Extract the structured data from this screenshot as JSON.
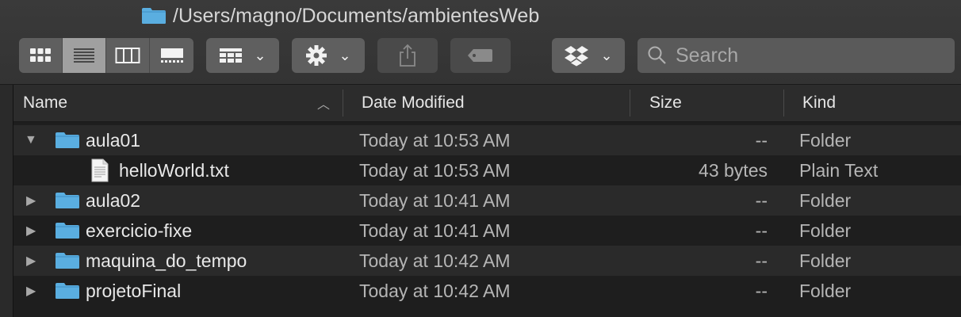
{
  "window": {
    "path": "/Users/magno/Documents/ambientesWeb"
  },
  "toolbar": {
    "view_modes": [
      "icon-view",
      "list-view",
      "column-view",
      "gallery-view"
    ],
    "active_view": "list-view",
    "group_icon": "group-grid-icon",
    "action_icon": "gear-icon",
    "share_icon": "share-icon",
    "tag_icon": "tag-icon",
    "dropbox_icon": "dropbox-icon",
    "search": {
      "placeholder": "Search"
    }
  },
  "columns": {
    "name": "Name",
    "date": "Date Modified",
    "size": "Size",
    "kind": "Kind"
  },
  "files": [
    {
      "name": "aula01",
      "date": "Today at 10:53 AM",
      "size": "--",
      "kind": "Folder",
      "type": "folder",
      "expanded": true,
      "level": 0
    },
    {
      "name": "helloWorld.txt",
      "date": "Today at 10:53 AM",
      "size": "43 bytes",
      "kind": "Plain Text",
      "type": "file",
      "level": 1
    },
    {
      "name": "aula02",
      "date": "Today at 10:41 AM",
      "size": "--",
      "kind": "Folder",
      "type": "folder",
      "expanded": false,
      "level": 0
    },
    {
      "name": "exercicio-fixe",
      "date": "Today at 10:41 AM",
      "size": "--",
      "kind": "Folder",
      "type": "folder",
      "expanded": false,
      "level": 0
    },
    {
      "name": "maquina_do_tempo",
      "date": "Today at 10:42 AM",
      "size": "--",
      "kind": "Folder",
      "type": "folder",
      "expanded": false,
      "level": 0
    },
    {
      "name": "projetoFinal",
      "date": "Today at 10:42 AM",
      "size": "--",
      "kind": "Folder",
      "type": "folder",
      "expanded": false,
      "level": 0
    }
  ],
  "colors": {
    "folder": "#5aaee0",
    "background": "#1e1e1e",
    "row_alt": "#2a2a2a"
  }
}
